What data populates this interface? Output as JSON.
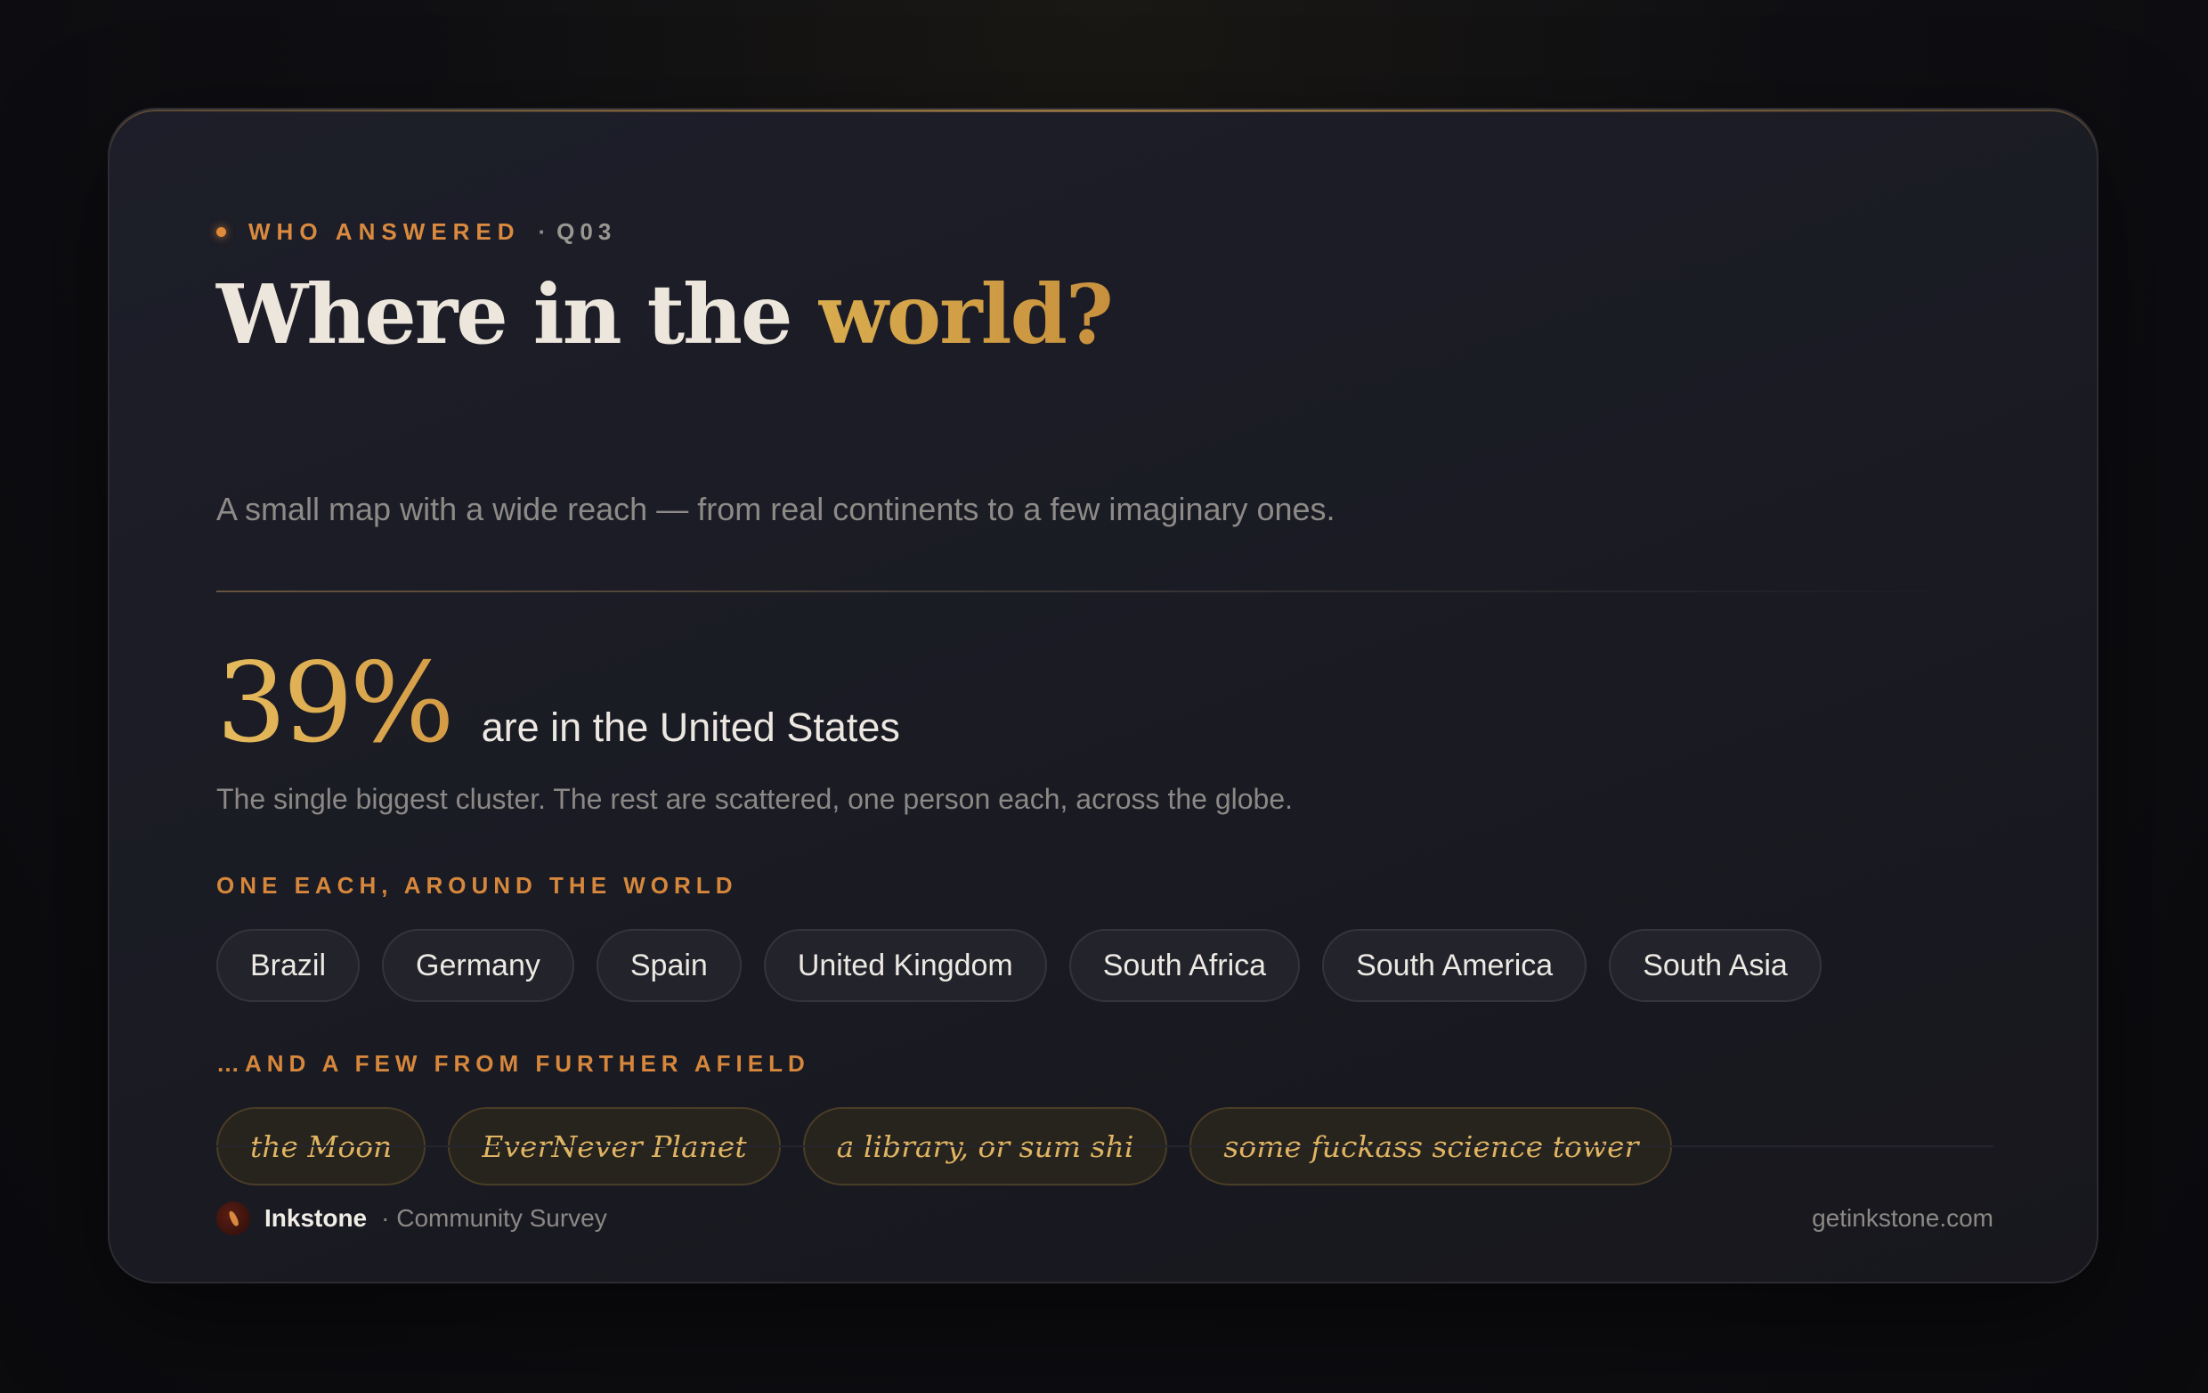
{
  "eyebrow": {
    "label": "WHO ANSWERED",
    "separator": "·",
    "question": "Q03"
  },
  "title": {
    "main": "Where in the",
    "accent": "world?"
  },
  "subtitle": "A small map with a wide reach — from real continents to a few imaginary ones.",
  "stat": {
    "value": "39%",
    "text": "are in the United States",
    "note": "The single biggest cluster. The rest are scattered, one person each, across the globe."
  },
  "sections": {
    "real_label": "ONE EACH, AROUND THE WORLD",
    "real_places": [
      "Brazil",
      "Germany",
      "Spain",
      "United Kingdom",
      "South Africa",
      "South America",
      "South Asia"
    ],
    "imaginary_label": "…AND A FEW FROM FURTHER AFIELD",
    "imaginary_places": [
      "the Moon",
      "EverNever Planet",
      "a library, or sum shi",
      "some fuckass science tower"
    ]
  },
  "footer": {
    "brand": "Inkstone",
    "brand_sub": "· Community Survey",
    "site": "getinkstone.com",
    "logo_icon": "ink-drop-icon"
  },
  "colors": {
    "accent_gold": "#d9ac4e",
    "accent_orange": "#d6873c",
    "background": "#1b1c25"
  }
}
